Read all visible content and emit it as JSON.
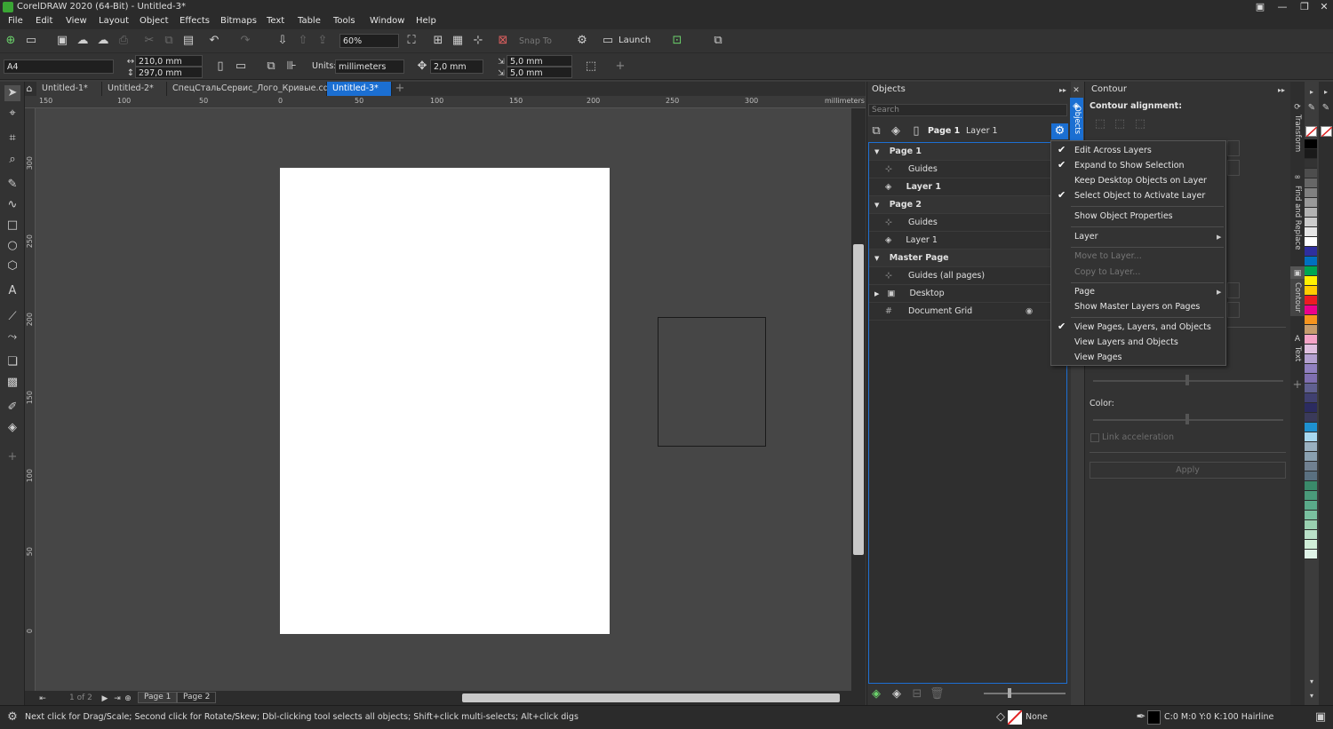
{
  "window": {
    "title": "CorelDRAW 2020 (64-Bit) - Untitled-3*"
  },
  "menu": [
    "File",
    "Edit",
    "View",
    "Layout",
    "Object",
    "Effects",
    "Bitmaps",
    "Text",
    "Table",
    "Tools",
    "Window",
    "Help"
  ],
  "toolbar": {
    "zoom": "60%",
    "snap_to": "Snap To",
    "launch": "Launch"
  },
  "propbar": {
    "page_size": "A4",
    "width": "210,0 mm",
    "height": "297,0 mm",
    "units_label": "Units:",
    "units_value": "millimeters",
    "nudge": "2,0 mm",
    "dup_x": "5,0 mm",
    "dup_y": "5,0 mm"
  },
  "doc_tabs": [
    {
      "label": "Untitled-1*",
      "active": false
    },
    {
      "label": "Untitled-2*",
      "active": false
    },
    {
      "label": "СпецСтальСервис_Лого_Кривые.cdr",
      "active": false
    },
    {
      "label": "Untitled-3*",
      "active": true
    }
  ],
  "ruler": {
    "h_labels": [
      "150",
      "100",
      "50",
      "0",
      "50",
      "100",
      "150",
      "200",
      "250",
      "300"
    ],
    "unit": "millimeters",
    "v_labels": [
      "300",
      "250",
      "200",
      "150",
      "100",
      "50",
      "0"
    ]
  },
  "page_nav": {
    "counter": "1 of 2",
    "tabs": [
      "Page 1",
      "Page 2"
    ]
  },
  "objects_panel": {
    "title": "Objects",
    "search_placeholder": "Search",
    "current_page": "Page 1",
    "current_layer": "Layer 1",
    "rows": [
      {
        "label": "Page 1",
        "type": "group"
      },
      {
        "label": "Guides",
        "type": "child"
      },
      {
        "label": "Layer 1",
        "type": "child-bold"
      },
      {
        "label": "Page 2",
        "type": "group"
      },
      {
        "label": "Guides",
        "type": "child"
      },
      {
        "label": "Layer 1",
        "type": "child"
      },
      {
        "label": "Master Page",
        "type": "group"
      },
      {
        "label": "Guides (all pages)",
        "type": "child"
      },
      {
        "label": "Desktop",
        "type": "child-collapsed"
      },
      {
        "label": "Document Grid",
        "type": "child"
      }
    ],
    "side_tab": "Objects"
  },
  "context_menu": {
    "items": [
      {
        "label": "Edit Across Layers",
        "checked": true,
        "disabled": false,
        "submenu": false
      },
      {
        "label": "Expand to Show Selection",
        "checked": true,
        "disabled": false,
        "submenu": false
      },
      {
        "label": "Keep Desktop Objects on Layer",
        "checked": false,
        "disabled": false,
        "submenu": false
      },
      {
        "label": "Select Object to Activate Layer",
        "checked": true,
        "disabled": false,
        "submenu": false
      },
      {
        "label": "Show Object Properties",
        "checked": false,
        "disabled": false,
        "submenu": false
      },
      {
        "label": "Layer",
        "checked": false,
        "disabled": false,
        "submenu": true
      },
      {
        "label": "Move to Layer...",
        "checked": false,
        "disabled": true,
        "submenu": false
      },
      {
        "label": "Copy to Layer...",
        "checked": false,
        "disabled": true,
        "submenu": false
      },
      {
        "label": "Page",
        "checked": false,
        "disabled": false,
        "submenu": true
      },
      {
        "label": "Show Master Layers on Pages",
        "checked": false,
        "disabled": false,
        "submenu": false
      },
      {
        "label": "View Pages, Layers, and Objects",
        "checked": true,
        "disabled": false,
        "submenu": false
      },
      {
        "label": "View Layers and Objects",
        "checked": false,
        "disabled": false,
        "submenu": false
      },
      {
        "label": "View Pages",
        "checked": false,
        "disabled": false,
        "submenu": false
      }
    ]
  },
  "contour_panel": {
    "title": "Contour",
    "alignment_label": "Contour alignment:",
    "color_label": "Color:",
    "link_acceleration": "Link acceleration",
    "apply": "Apply"
  },
  "dock_tabs": [
    "Transform",
    "Find and Replace",
    "Contour",
    "Text"
  ],
  "palette_colors": [
    "#000000",
    "#1a1a1a",
    "#333333",
    "#4d4d4d",
    "#666666",
    "#808080",
    "#999999",
    "#b3b3b3",
    "#cccccc",
    "#e6e6e6",
    "#ffffff",
    "#2f2f9f",
    "#0070c0",
    "#00a651",
    "#fff200",
    "#ffcc00",
    "#ed1c24",
    "#ec008c",
    "#f7941d",
    "#c69c6d",
    "#f5a3c7",
    "#e0c0e0",
    "#b3a0d0",
    "#9080c0",
    "#7f6fb0",
    "#606090",
    "#404070",
    "#2b2b60",
    "#3a3a5a",
    "#1e90d0",
    "#a8d8f0",
    "#9ab0c0",
    "#8aa0b0",
    "#708090",
    "#5a7080",
    "#3a8a6a",
    "#4a9a7a",
    "#5aaa8a",
    "#7ac0a0",
    "#9ad0b0",
    "#bae0c8",
    "#d0eed8",
    "#e0f4e8"
  ],
  "status": {
    "hint": "Next click for Drag/Scale; Second click for Rotate/Skew; Dbl-clicking tool selects all objects; Shift+click multi-selects; Alt+click digs",
    "fill": "None",
    "outline": "C:0 M:0 Y:0 K:100  Hairline"
  }
}
